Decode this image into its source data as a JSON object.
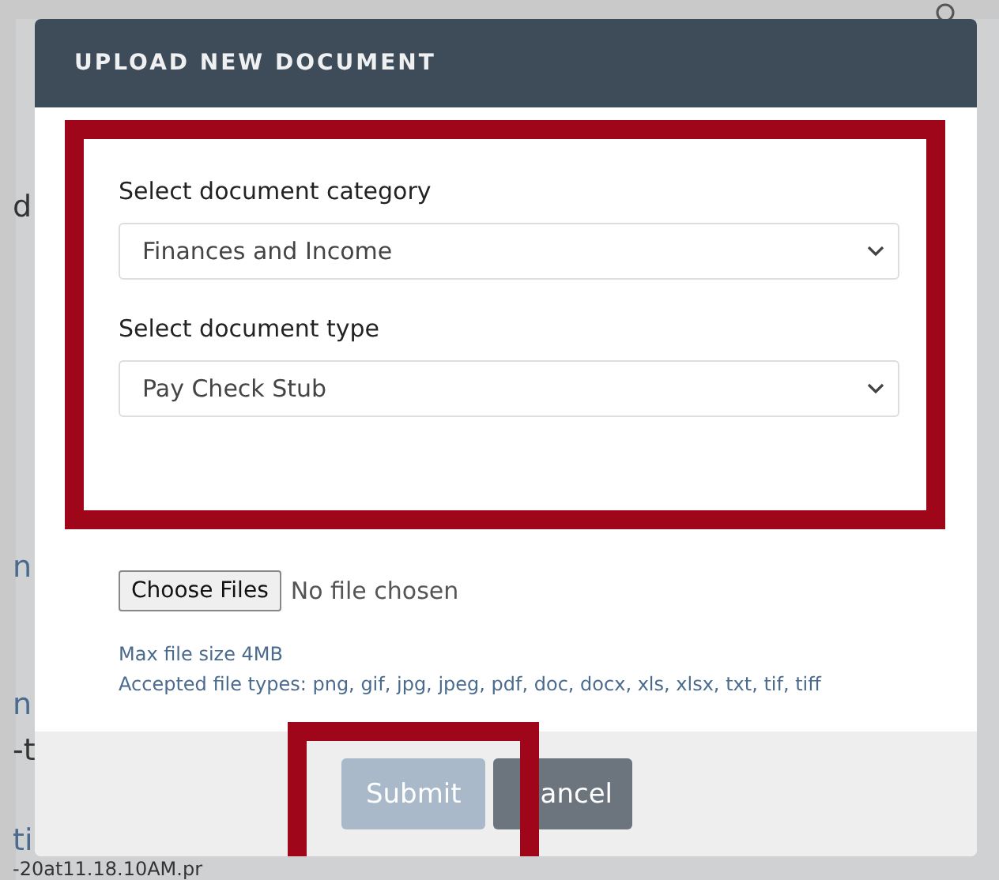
{
  "background_page": {
    "fragments": [
      "d",
      "n",
      "n",
      "-t",
      "ti",
      "-20at11.18.10AM.pr"
    ]
  },
  "modal": {
    "title": "UPLOAD NEW DOCUMENT",
    "fields": [
      {
        "label": "Select document category",
        "value": "Finances and Income"
      },
      {
        "label": "Select document type",
        "value": "Pay Check Stub"
      }
    ],
    "file_input": {
      "button": "Choose Files",
      "status": "No file chosen"
    },
    "notes": [
      "Max file size 4MB",
      "Accepted file types: png, gif, jpg, jpeg, pdf, doc, docx, xls, xlsx, txt, tif, tiff"
    ],
    "buttons": [
      {
        "label": "Submit",
        "disabled": true
      },
      {
        "label": "ancel",
        "disabled": false
      }
    ]
  }
}
